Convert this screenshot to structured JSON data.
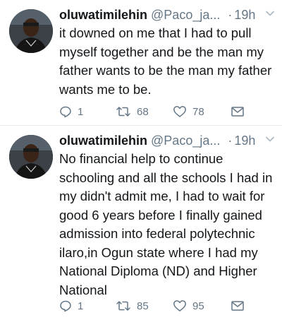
{
  "tweets": [
    {
      "author_name": "oluwatimilehin",
      "author_handle": "@Paco_ja...",
      "separator": "·",
      "time": "19h",
      "text": "it downed on me that I had to pull myself together and be the man my father wants to be the man my father wants me to be.",
      "replies": "1",
      "retweets": "68",
      "likes": "78"
    },
    {
      "author_name": "oluwatimilehin",
      "author_handle": "@Paco_ja...",
      "separator": "·",
      "time": "19h",
      "text": "No financial help to continue schooling and all the schools I had in my didn't admit me, I had to wait for good 6 years before I finally gained admission into federal polytechnic ilaro,in Ogun state where I had my National Diploma (ND) and Higher National",
      "replies": "1",
      "retweets": "85",
      "likes": "95"
    }
  ],
  "icons": {
    "reply": "reply-icon",
    "retweet": "retweet-icon",
    "like": "heart-icon",
    "dm": "envelope-icon",
    "more": "chevron-down-icon"
  },
  "colors": {
    "text": "#14171a",
    "secondary": "#657786",
    "divider": "#e6ecf0"
  }
}
